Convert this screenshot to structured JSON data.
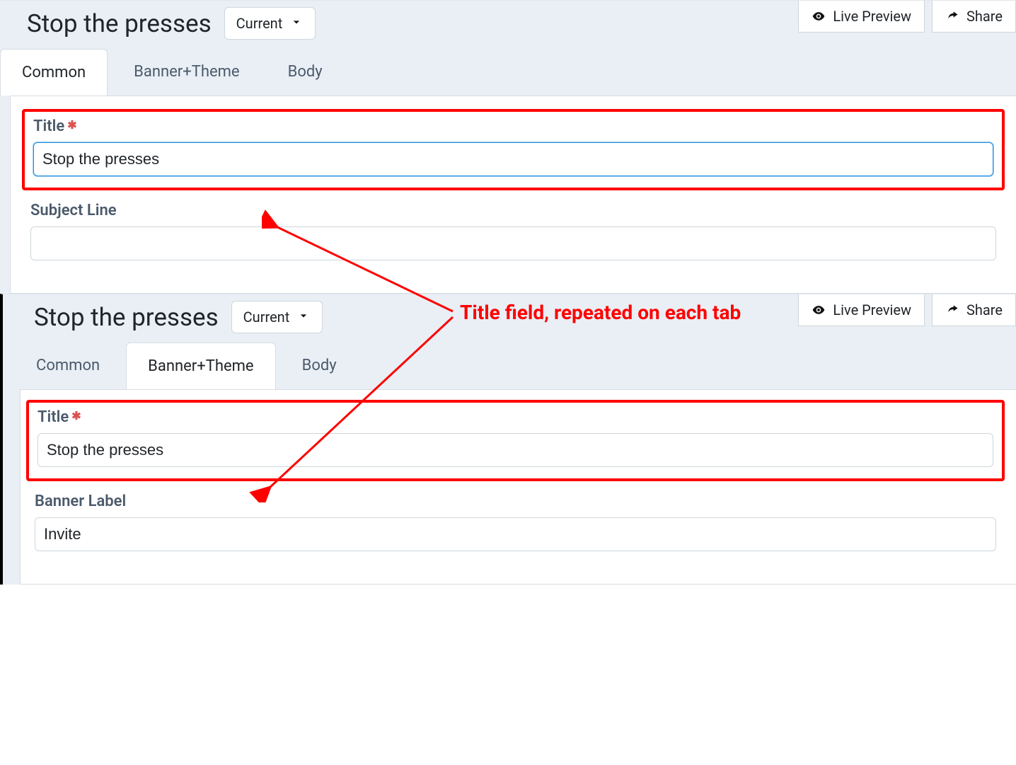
{
  "annotation": {
    "text": "Title field, repeated on each tab"
  },
  "top": {
    "header": {
      "title": "Stop the presses",
      "version_label": "Current",
      "live_preview": "Live Preview",
      "share": "Share"
    },
    "tabs": {
      "common": "Common",
      "banner_theme": "Banner+Theme",
      "body": "Body",
      "active": "common"
    },
    "form": {
      "title_label": "Title",
      "title_value": "Stop the presses",
      "subject_label": "Subject Line",
      "subject_value": ""
    }
  },
  "bottom": {
    "header": {
      "title": "Stop the presses",
      "version_label": "Current",
      "live_preview": "Live Preview",
      "share": "Share"
    },
    "tabs": {
      "common": "Common",
      "banner_theme": "Banner+Theme",
      "body": "Body",
      "active": "banner_theme"
    },
    "form": {
      "title_label": "Title",
      "title_value": "Stop the presses",
      "banner_label": "Banner Label",
      "banner_value": "Invite"
    }
  }
}
